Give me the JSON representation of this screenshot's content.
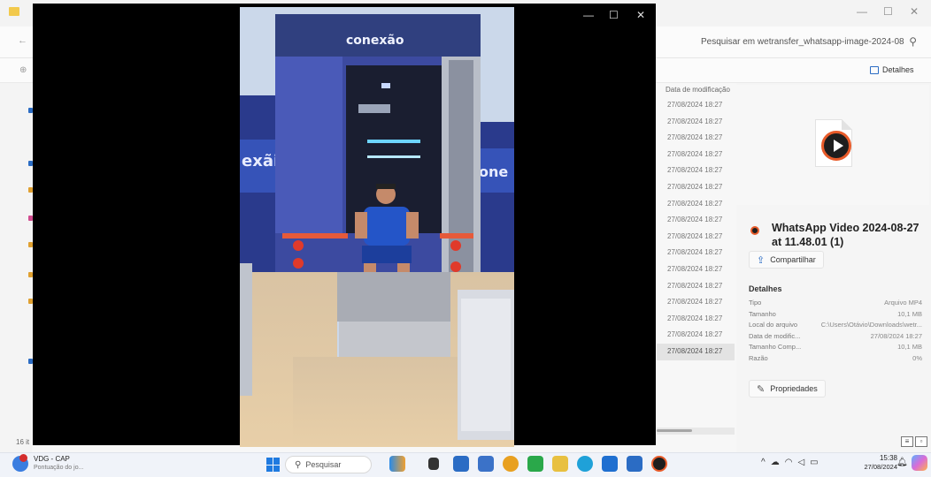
{
  "explorer": {
    "search_placeholder": "Pesquisar em wetransfer_whatsapp-image-2024-08",
    "details_toggle_label": "Detalhes",
    "column_header": "Data de modificação",
    "rows": [
      "27/08/2024 18:27",
      "27/08/2024 18:27",
      "27/08/2024 18:27",
      "27/08/2024 18:27",
      "27/08/2024 18:27",
      "27/08/2024 18:27",
      "27/08/2024 18:27",
      "27/08/2024 18:27",
      "27/08/2024 18:27",
      "27/08/2024 18:27",
      "27/08/2024 18:27",
      "27/08/2024 18:27",
      "27/08/2024 18:27",
      "27/08/2024 18:27",
      "27/08/2024 18:27",
      "27/08/2024 18:27"
    ],
    "selected_row_index": 15,
    "status_left": "16 it",
    "window_controls": {
      "minimize": "—",
      "maximize": "☐",
      "close": "✕"
    }
  },
  "details_pane": {
    "file_name": "WhatsApp Video 2024-08-27 at 11.48.01 (1)",
    "share_label": "Compartilhar",
    "section_title": "Detalhes",
    "properties": [
      {
        "label": "Tipo",
        "value": "Arquivo MP4"
      },
      {
        "label": "Tamanho",
        "value": "10,1 MB"
      },
      {
        "label": "Local do arquivo",
        "value": "C:\\Users\\Otávio\\Downloads\\wetr..."
      },
      {
        "label": "Data de modific...",
        "value": "27/08/2024 18:27"
      },
      {
        "label": "Tamanho Comp...",
        "value": "10,1 MB"
      },
      {
        "label": "Razão",
        "value": "0%"
      }
    ],
    "properties_button_label": "Propriedades"
  },
  "player": {
    "controls": {
      "minimize": "—",
      "maximize": "☐",
      "close": "✕"
    },
    "video_logo_text": "conexão",
    "video_side_text_left": "exãi",
    "video_side_text_right": "one"
  },
  "taskbar": {
    "weather_title": "VDG - CAP",
    "weather_subtitle": "Pontuação do jo...",
    "search_label": "Pesquisar",
    "clock_time": "15:38",
    "clock_date": "27/08/2024",
    "apps": [
      "files-app",
      "explorer",
      "store",
      "chrome",
      "whatsapp",
      "folder",
      "edge",
      "mail",
      "photos",
      "media-player"
    ]
  },
  "colors": {
    "accent": "#1f7ae0",
    "video_orange": "#e85b2a"
  }
}
